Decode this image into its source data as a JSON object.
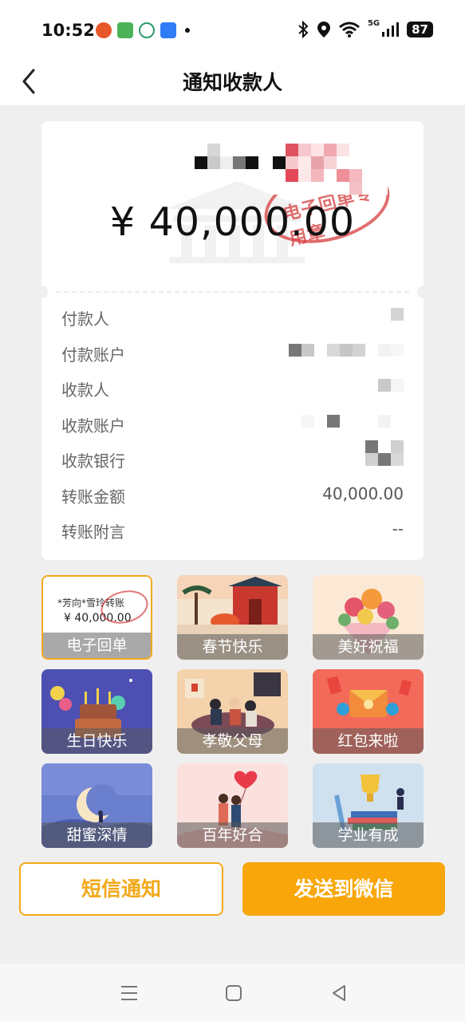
{
  "status_bar": {
    "time": "10:52",
    "network": "5G",
    "battery": "87",
    "icons": [
      "app-notification-icon",
      "messages-icon",
      "app-icon",
      "calendar-icon",
      "bluetooth-icon",
      "location-icon",
      "wifi-icon",
      "signal-icon",
      "battery-icon"
    ]
  },
  "header": {
    "title": "通知收款人",
    "back_icon": "chevron-left-icon"
  },
  "receipt": {
    "amount": "¥ 40,000.00",
    "stamp_text": "电子回单专用章",
    "rows": [
      {
        "label": "付款人",
        "value": ""
      },
      {
        "label": "付款账户",
        "value": ""
      },
      {
        "label": "收款人",
        "value": ""
      },
      {
        "label": "收款账户",
        "value": ""
      },
      {
        "label": "收款银行",
        "value": ""
      },
      {
        "label": "转账金额",
        "value": "40,000.00"
      },
      {
        "label": "转账附言",
        "value": "--"
      }
    ]
  },
  "templates": {
    "selected": "电子回单",
    "mini_names": "*芳向*雪玲转账",
    "mini_amount": "¥ 40,000.00",
    "items": [
      {
        "label": "电子回单"
      },
      {
        "label": "春节快乐"
      },
      {
        "label": "美好祝福"
      },
      {
        "label": "生日快乐"
      },
      {
        "label": "孝敬父母"
      },
      {
        "label": "红包来啦"
      },
      {
        "label": "甜蜜深情"
      },
      {
        "label": "百年好合"
      },
      {
        "label": "学业有成"
      }
    ]
  },
  "actions": {
    "sms_label": "短信通知",
    "wechat_label": "发送到微信"
  },
  "colors": {
    "accent": "#f8a60a",
    "background": "#efefef",
    "stamp": "#d63c3c"
  },
  "system_nav": [
    "menu-icon",
    "home-icon",
    "back-triangle-icon"
  ]
}
